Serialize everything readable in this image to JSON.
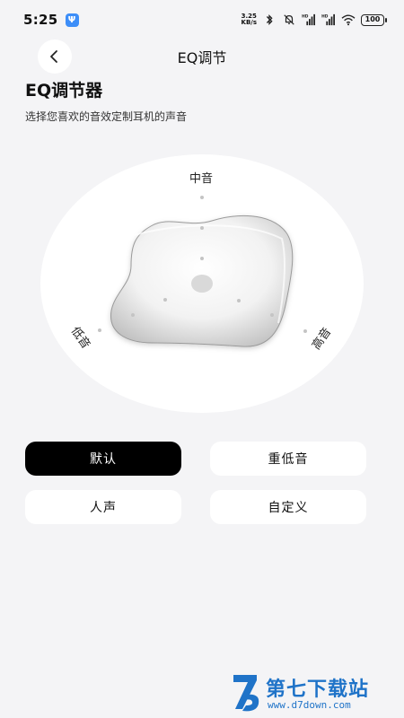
{
  "status_bar": {
    "time": "5:25",
    "app_badge": "Ψ",
    "net_speed_value": "3.25",
    "net_speed_unit": "KB/s",
    "signal1_label": "HD",
    "signal2_label": "HD",
    "battery": "100",
    "icons": [
      "bluetooth-icon",
      "mute-bell-icon",
      "signal-icon",
      "signal-icon",
      "wifi-icon",
      "battery-icon"
    ]
  },
  "nav": {
    "title": "EQ调节",
    "back_icon": "chevron-left-icon"
  },
  "header": {
    "title": "EQ调节器",
    "subtitle": "选择您喜欢的音效定制耳机的声音"
  },
  "eq": {
    "label_mid": "中音",
    "label_low": "低音",
    "label_high": "高音",
    "knob_color": "#d9d9d9"
  },
  "presets": [
    {
      "label": "默认",
      "active": true
    },
    {
      "label": "重低音",
      "active": false
    },
    {
      "label": "人声",
      "active": false
    },
    {
      "label": "自定义",
      "active": false
    }
  ],
  "watermark": {
    "name": "第七下载站",
    "url": "www.d7down.com",
    "color": "#1f73c8"
  },
  "colors": {
    "background": "#f4f4f6",
    "active_preset": "#000000",
    "card": "#ffffff"
  }
}
